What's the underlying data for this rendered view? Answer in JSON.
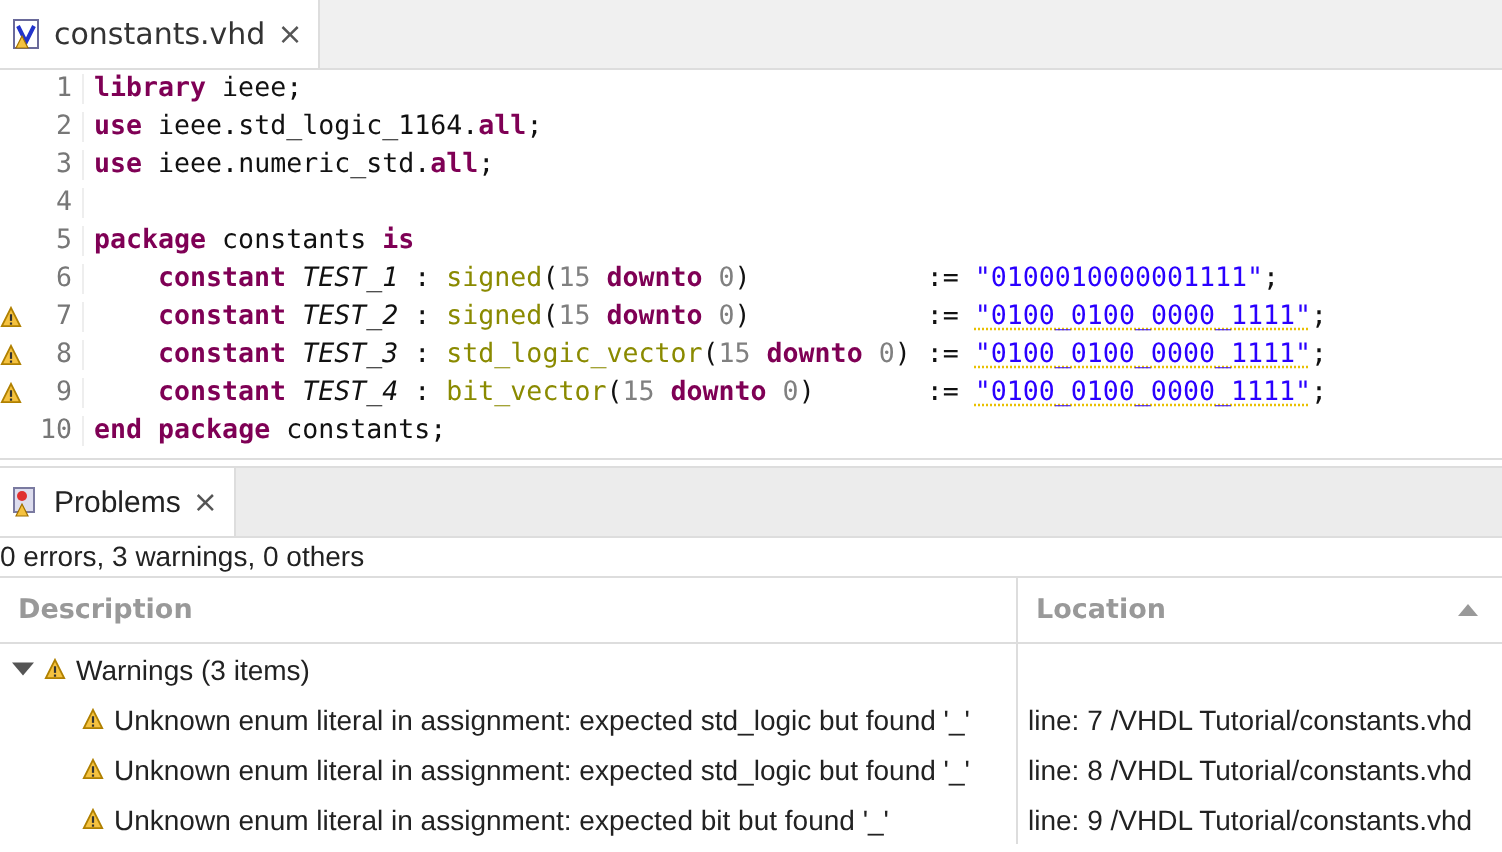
{
  "editor": {
    "tab": {
      "title": "constants.vhd",
      "close": "×",
      "selected": true
    },
    "lines": [
      {
        "number": "1",
        "warning": false,
        "tokens": [
          {
            "kind": "keyword",
            "text": "library"
          },
          {
            "kind": "plain",
            "text": " ieee;"
          }
        ]
      },
      {
        "number": "2",
        "warning": false,
        "tokens": [
          {
            "kind": "keyword",
            "text": "use"
          },
          {
            "kind": "plain",
            "text": " ieee.std_logic_1164."
          },
          {
            "kind": "keyword",
            "text": "all"
          },
          {
            "kind": "plain",
            "text": ";"
          }
        ]
      },
      {
        "number": "3",
        "warning": false,
        "tokens": [
          {
            "kind": "keyword",
            "text": "use"
          },
          {
            "kind": "plain",
            "text": " ieee.numeric_std."
          },
          {
            "kind": "keyword",
            "text": "all"
          },
          {
            "kind": "plain",
            "text": ";"
          }
        ]
      },
      {
        "number": "4",
        "warning": false
      },
      {
        "number": "5",
        "warning": false,
        "tokens": [
          {
            "kind": "keyword",
            "text": "package"
          },
          {
            "kind": "plain",
            "text": " constants "
          },
          {
            "kind": "keyword",
            "text": "is"
          }
        ]
      },
      {
        "number": "6",
        "warning": false,
        "tokens": [
          {
            "kind": "keyword",
            "text": "    constant"
          },
          {
            "kind": "name",
            "text": " TEST_1"
          },
          {
            "kind": "plain",
            "text": " : "
          },
          {
            "kind": "type",
            "text": "signed"
          },
          {
            "kind": "plain",
            "text": "("
          },
          {
            "kind": "number",
            "text": "15"
          },
          {
            "kind": "keyword",
            "text": " downto"
          },
          {
            "kind": "number",
            "text": " 0"
          },
          {
            "kind": "plain",
            "text": ")           := "
          },
          {
            "kind": "string",
            "text": "\"0100010000001111\""
          },
          {
            "kind": "plain",
            "text": ";"
          }
        ]
      },
      {
        "number": "7",
        "warning": true,
        "tokens": [
          {
            "kind": "keyword",
            "text": "    constant"
          },
          {
            "kind": "name",
            "text": " TEST_2"
          },
          {
            "kind": "plain",
            "text": " : "
          },
          {
            "kind": "type",
            "text": "signed"
          },
          {
            "kind": "plain",
            "text": "("
          },
          {
            "kind": "number",
            "text": "15"
          },
          {
            "kind": "keyword",
            "text": " downto"
          },
          {
            "kind": "number",
            "text": " 0"
          },
          {
            "kind": "plain",
            "text": ")           := "
          },
          {
            "kind": "string-warned",
            "text": "\"0100_0100_0000_1111\""
          },
          {
            "kind": "plain",
            "text": ";"
          }
        ]
      },
      {
        "number": "8",
        "warning": true,
        "tokens": [
          {
            "kind": "keyword",
            "text": "    constant"
          },
          {
            "kind": "name",
            "text": " TEST_3"
          },
          {
            "kind": "plain",
            "text": " : "
          },
          {
            "kind": "type",
            "text": "std_logic_vector"
          },
          {
            "kind": "plain",
            "text": "("
          },
          {
            "kind": "number",
            "text": "15"
          },
          {
            "kind": "keyword",
            "text": " downto"
          },
          {
            "kind": "number",
            "text": " 0"
          },
          {
            "kind": "plain",
            "text": ") := "
          },
          {
            "kind": "string-warned",
            "text": "\"0100_0100_0000_1111\""
          },
          {
            "kind": "plain",
            "text": ";"
          }
        ]
      },
      {
        "number": "9",
        "warning": true,
        "tokens": [
          {
            "kind": "keyword",
            "text": "    constant"
          },
          {
            "kind": "name",
            "text": " TEST_4"
          },
          {
            "kind": "plain",
            "text": " : "
          },
          {
            "kind": "type",
            "text": "bit_vector"
          },
          {
            "kind": "plain",
            "text": "("
          },
          {
            "kind": "number",
            "text": "15"
          },
          {
            "kind": "keyword",
            "text": " downto"
          },
          {
            "kind": "number",
            "text": " 0"
          },
          {
            "kind": "plain",
            "text": ")       := "
          },
          {
            "kind": "string-warned",
            "text": "\"0100_0100_0000_1111\""
          },
          {
            "kind": "plain",
            "text": ";"
          }
        ]
      },
      {
        "number": "10",
        "warning": false,
        "tokens": [
          {
            "kind": "keyword",
            "text": "end"
          },
          {
            "kind": "keyword",
            "text": " package"
          },
          {
            "kind": "plain",
            "text": " constants;"
          }
        ]
      }
    ]
  },
  "problems": {
    "tab": {
      "title": "Problems",
      "close": "×",
      "selected": true
    },
    "summary": "0 errors, 3 warnings, 0 others",
    "columns": [
      {
        "label": "Description",
        "sorted": false
      },
      {
        "label": "Location",
        "sorted": true
      }
    ],
    "groups": [
      {
        "label": "Warnings (3 items)",
        "expanded": true,
        "children": [
          {
            "description": "Unknown enum literal in assignment: expected std_logic but found '_'",
            "location": "line: 7 /VHDL Tutorial/constants.vhd"
          },
          {
            "description": "Unknown enum literal in assignment: expected std_logic but found '_'",
            "location": "line: 8 /VHDL Tutorial/constants.vhd"
          },
          {
            "description": "Unknown enum literal in assignment: expected bit but found '_'",
            "location": "line: 9 /VHDL Tutorial/constants.vhd"
          }
        ]
      }
    ]
  }
}
